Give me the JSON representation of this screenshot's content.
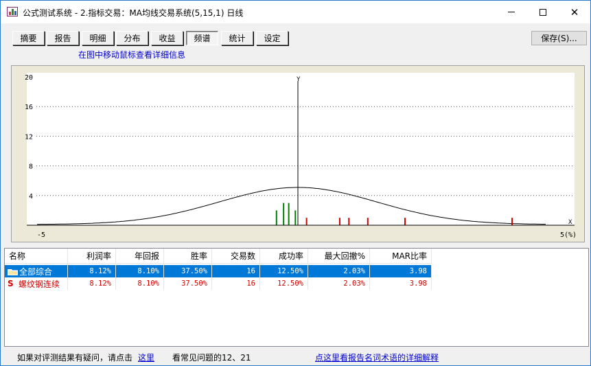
{
  "window": {
    "title": "公式测试系统 - 2.指标交易：MA均线交易系统(5,15,1) 日线",
    "minimize_icon": "minimize-icon",
    "maximize_icon": "maximize-icon",
    "close_icon": "close-icon",
    "close_glyph": "✕"
  },
  "tabs": [
    {
      "label": "摘要",
      "active": false
    },
    {
      "label": "报告",
      "active": false
    },
    {
      "label": "明细",
      "active": false
    },
    {
      "label": "分布",
      "active": false
    },
    {
      "label": "收益",
      "active": false
    },
    {
      "label": "频谱",
      "active": true
    },
    {
      "label": "统计",
      "active": false
    },
    {
      "label": "设定",
      "active": false
    }
  ],
  "save_button": "保存(S)...",
  "hint": "在图中移动鼠标查看详细信息",
  "chart_data": {
    "type": "bar",
    "y_axis_label": "Y",
    "x_axis_label": "X",
    "x_min_label": "-5",
    "x_max_label": "5(%)",
    "xlim": [
      -5,
      5
    ],
    "ylim": [
      0,
      20
    ],
    "y_ticks": [
      "20",
      "16",
      "12",
      "8",
      "4"
    ],
    "grid": "dotted horizontal",
    "curve": "normal distribution curve, peak ≈ 5 at x ≈ 0",
    "negative_bars": {
      "color": "#008000",
      "x": [
        -0.42,
        -0.28,
        -0.18,
        -0.05
      ],
      "values": [
        2,
        3,
        3,
        2
      ]
    },
    "positive_bars": {
      "color": "#d00000",
      "x": [
        0.17,
        0.82,
        1.0,
        1.37,
        2.1,
        4.2
      ],
      "values": [
        1,
        1,
        1,
        1,
        1,
        1
      ]
    }
  },
  "table": {
    "columns": [
      "名称",
      "利润率",
      "年回报",
      "胜率",
      "交易数",
      "成功率",
      "最大回撤%",
      "MAR比率"
    ],
    "rows": [
      {
        "name": "全部综合",
        "icon": "folder-icon",
        "selected": true,
        "values": [
          "8.12%",
          "8.10%",
          "37.50%",
          "16",
          "12.50%",
          "2.03%",
          "3.98"
        ]
      },
      {
        "name": "螺纹钢连续",
        "icon": "s-icon",
        "icon_glyph": "S",
        "selected": false,
        "values": [
          "8.12%",
          "8.10%",
          "37.50%",
          "16",
          "12.50%",
          "2.03%",
          "3.98"
        ]
      }
    ]
  },
  "footer": {
    "question_text": "如果对评测结果有疑问，请点击",
    "here_link": "这里",
    "faq_text": "看常见问题的12、21",
    "glossary_link": "点这里看报告名词术语的详细解释"
  }
}
